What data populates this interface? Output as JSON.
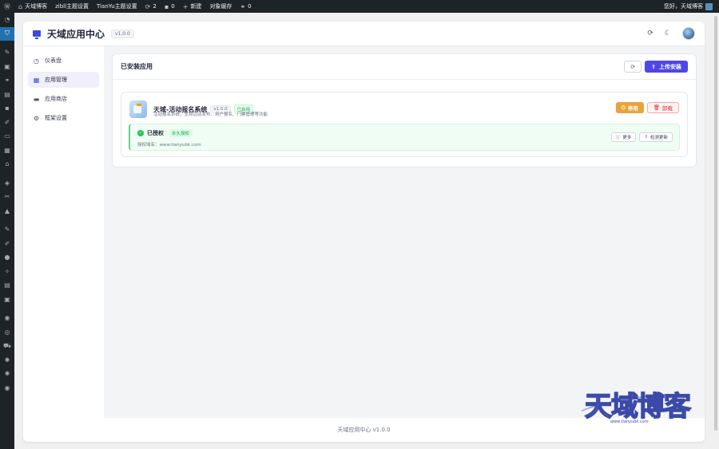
{
  "adminbar": {
    "site_name": "天域博客",
    "zibll_settings": "zibll主题设置",
    "tianyu_settings": "TianYu主题设置",
    "updates_count": "2",
    "comments_count": "0",
    "new_label": "新建",
    "object_cache": "对象缓存",
    "links_count": "0",
    "greeting": "您好，天域博客"
  },
  "app": {
    "title": "天域应用中心",
    "version": "v1.0.0"
  },
  "nav": {
    "items": [
      {
        "label": "仪表盘",
        "icon": "dashboard-icon"
      },
      {
        "label": "应用管理",
        "icon": "grid-icon"
      },
      {
        "label": "应用商店",
        "icon": "store-icon"
      },
      {
        "label": "框架设置",
        "icon": "gear-icon"
      }
    ],
    "active": 1
  },
  "panel": {
    "title": "已安装应用",
    "upload_label": "上传安装"
  },
  "installed_app": {
    "name": "天域-活动报名系统",
    "version": "v1.0.0",
    "status": "已启用",
    "description": "活动报名系统，支持活动发布、用户报名、门票管理等功能",
    "disable_label": "停用",
    "uninstall_label": "卸载",
    "license": {
      "title": "已授权",
      "badge": "永久授权",
      "domain": "授权域名：www.tianyubk.com",
      "more_label": "更多",
      "check_update_label": "检测更新"
    }
  },
  "footer": {
    "text": "天域应用中心 v1.0.0"
  },
  "watermark": {
    "text": "天域博客",
    "url": "www.tianyubk.com"
  },
  "colors": {
    "primary": "#4f46e5",
    "warning": "#e8a33a",
    "danger": "#dc2626",
    "success": "#22c55e",
    "adminbar": "#1d2327"
  }
}
